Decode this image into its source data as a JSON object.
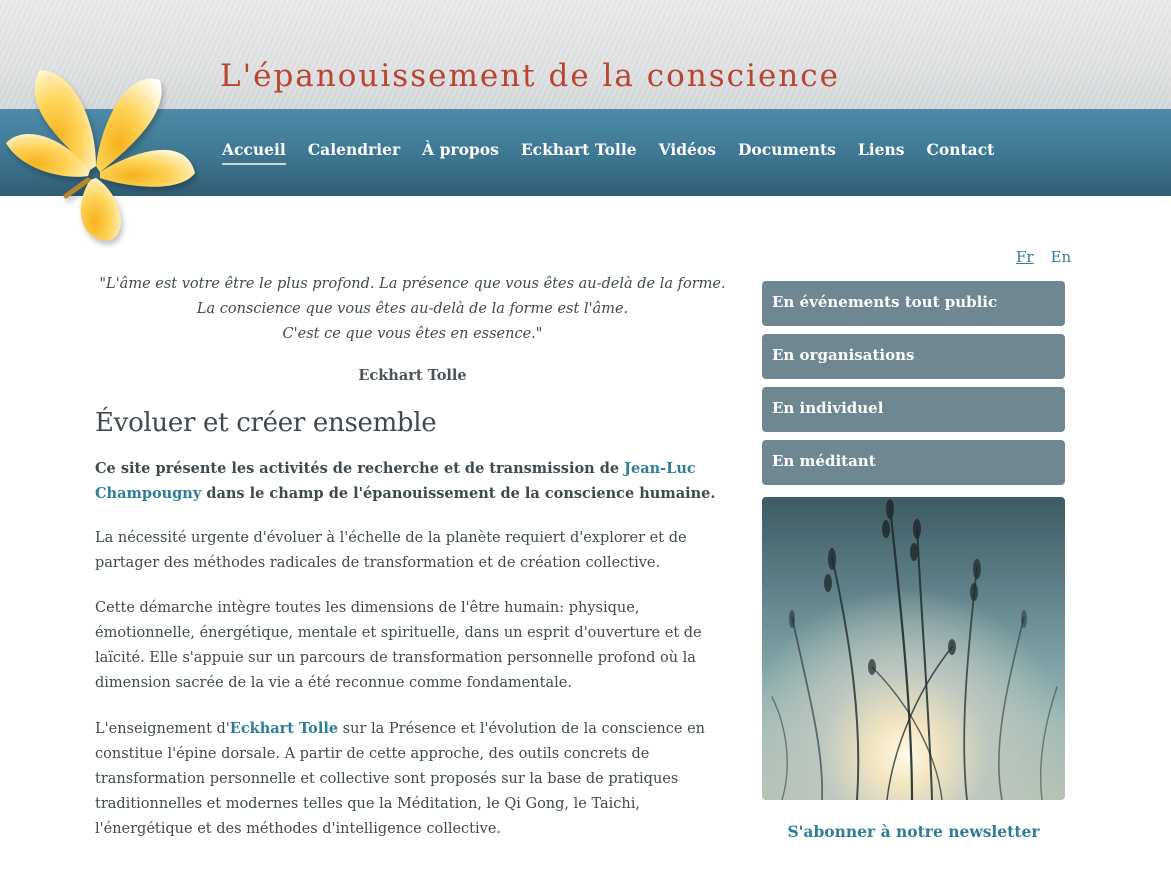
{
  "header": {
    "title": "L'épanouissement de la conscience",
    "nav": [
      "Accueil",
      "Calendrier",
      "À propos",
      "Eckhart Tolle",
      "Vidéos",
      "Documents",
      "Liens",
      "Contact"
    ],
    "active_nav": "Accueil"
  },
  "language": {
    "fr": "Fr",
    "en": "En",
    "current": "Fr"
  },
  "main": {
    "quote_line1": "\"L'âme est votre être le plus profond. La présence que vous êtes au-delà de la forme.",
    "quote_line2": "La conscience que vous êtes au-delà de la forme est l'âme.",
    "quote_line3": "C'est ce que vous êtes en essence.\"",
    "quote_author": "Eckhart Tolle",
    "section_title": "Évoluer et créer ensemble",
    "lead_before": "Ce site présente les activités de recherche et de transmission de ",
    "lead_link": "Jean-Luc Champougny",
    "lead_after": " dans le champ de l'épanouissement de la conscience humaine.",
    "para1": "La nécessité urgente d'évoluer à l'échelle de la planète requiert d'explorer et de partager des méthodes radicales de transformation et de création collective.",
    "para2": "Cette démarche intègre toutes les dimensions de l'être humain: physique, émotionnelle, énergétique, mentale et spirituelle, dans un esprit d'ouverture et de laïcité. Elle s'appuie sur un parcours de transformation personnelle profond où la dimension sacrée de la vie a été reconnue comme fondamentale.",
    "para3_before": "L'enseignement d'",
    "para3_link": "Eckhart Tolle",
    "para3_after": " sur la Présence et l'évolution de la conscience en constitue l'épine dorsale. A partir de cette approche, des outils concrets de transformation personnelle et collective sont proposés sur la base de pratiques traditionnelles et modernes telles que la Méditation, le Qi Gong, le Taichi, l'énergétique et des méthodes d'intelligence collective."
  },
  "sidebar": {
    "buttons": [
      "En événements tout public",
      "En organisations",
      "En individuel",
      "En méditant"
    ],
    "newsletter": "S'abonner à notre newsletter"
  },
  "colors": {
    "title": "#b9442f",
    "nav_bar": "#3e7691",
    "link": "#2f7e97",
    "sidebar_button": "#6e8791"
  },
  "icons": {
    "logo": "frangipani-flower-icon"
  }
}
